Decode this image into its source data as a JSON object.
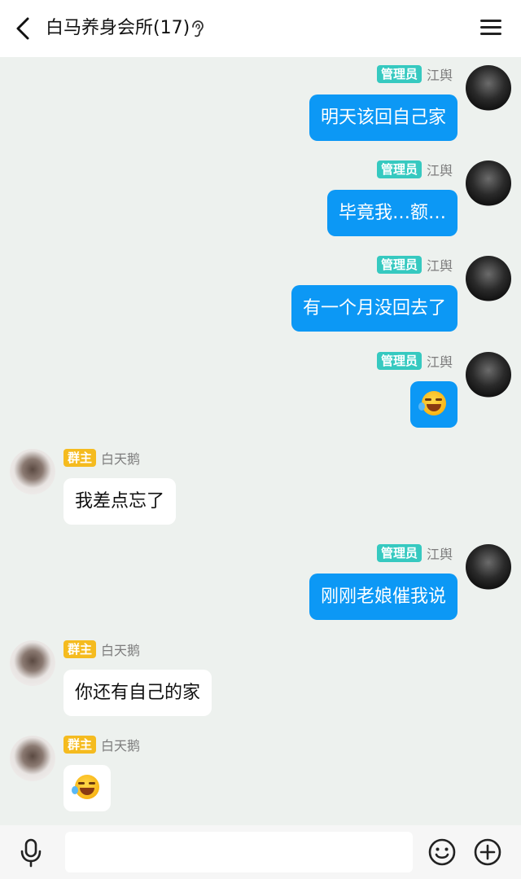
{
  "header": {
    "title": "白马养身会所(17)",
    "back_icon": "chevron-left-icon",
    "ear_icon": "ear-icon",
    "menu_icon": "hamburger-menu-icon"
  },
  "badges": {
    "admin": "管理员",
    "owner": "群主"
  },
  "colors": {
    "outgoing_bubble": "#0c98f5",
    "incoming_bubble": "#ffffff",
    "admin_badge": "#36c9c0",
    "owner_badge": "#f5bb1f",
    "chat_background": "#edf1ee"
  },
  "messages": [
    {
      "sender": "江舆",
      "role": "管理员",
      "text": "明天该回自己家"
    },
    {
      "sender": "江舆",
      "role": "管理员",
      "text": "毕竟我…额…"
    },
    {
      "sender": "江舆",
      "role": "管理员",
      "text": "有一个月没回去了"
    },
    {
      "sender": "江舆",
      "role": "管理员",
      "emoji": "laughing-crying-emoji"
    },
    {
      "sender": "白天鹅",
      "role": "群主",
      "text": "我差点忘了"
    },
    {
      "sender": "江舆",
      "role": "管理员",
      "text": "刚刚老娘催我说"
    },
    {
      "sender": "白天鹅",
      "role": "群主",
      "text": "你还有自己的家"
    },
    {
      "sender": "白天鹅",
      "role": "群主",
      "emoji": "laughing-crying-emoji"
    }
  ],
  "input_bar": {
    "placeholder": "",
    "mic_icon": "microphone-icon",
    "emoji_icon": "smiley-icon",
    "plus_icon": "plus-circle-icon"
  }
}
